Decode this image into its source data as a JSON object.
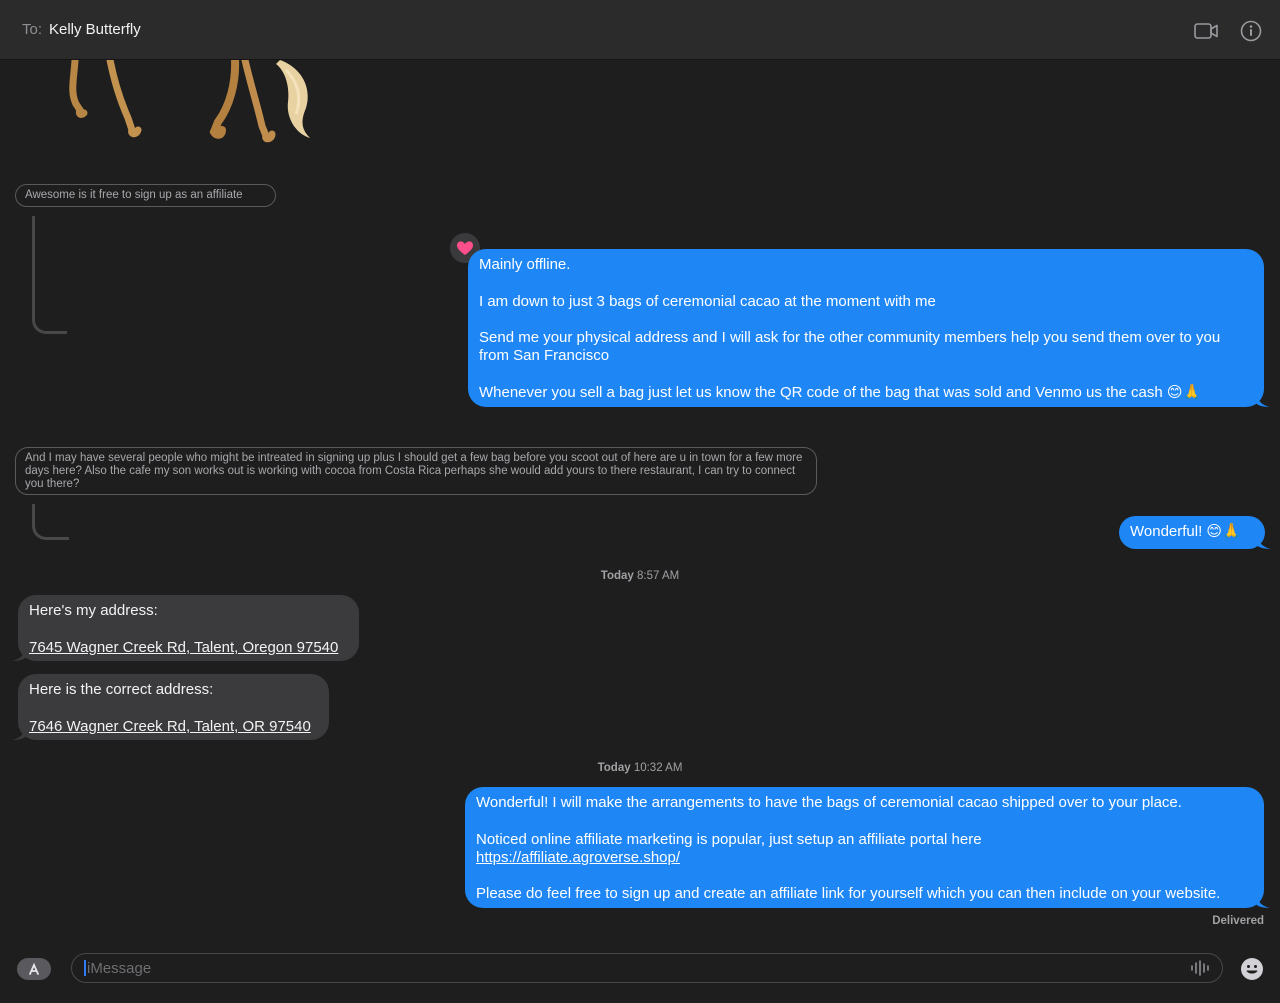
{
  "header": {
    "to_label": "To:",
    "recipient": "Kelly Butterfly",
    "icons": [
      "video-camera-icon",
      "info-icon"
    ]
  },
  "replies": {
    "reply1": "Awesome is it free to sign up as an affiliate",
    "reply2": "And I may have several people who might be intreated in signing up plus I should get a few bag before you scoot out of here are u in town for a few more days here?  Also the cafe my son works out is working with cocoa from Costa Rica perhaps she would add yours to there restaurant, I can try to connect you there?"
  },
  "messages": {
    "m1": {
      "l1": "Mainly offline.",
      "l2": "I am down to just 3 bags of ceremonial cacao at the moment with me",
      "l3": "Send me your physical address and I will ask for the other community members help you send them over to you from San Francisco",
      "l4": "Whenever you sell a bag just let us know the QR code of the bag that was sold and Venmo us the cash 😊🙏",
      "tapback": "heart"
    },
    "m2": {
      "text": "Wonderful! 😊🙏"
    },
    "m3": {
      "l1": "Here's my address:",
      "l2": "7645 Wagner Creek Rd, Talent, Oregon 97540"
    },
    "m4": {
      "l1": "Here is the correct address:",
      "l2": "7646 Wagner Creek Rd, Talent, OR 97540"
    },
    "m5": {
      "l1": "Wonderful! I will make the arrangements to have the bags of ceremonial cacao shipped over to your place.",
      "l2": "Noticed online affiliate marketing is popular, just setup an affiliate portal here",
      "l3": "https://affiliate.agroverse.shop/",
      "l4": "Please do feel free to sign up and create an affiliate link for yourself which you can then include on your website."
    }
  },
  "timestamps": {
    "t1_day": "Today",
    "t1_time": "8:57 AM",
    "t2_day": "Today",
    "t2_time": "10:32 AM"
  },
  "status": {
    "delivered": "Delivered"
  },
  "composer": {
    "placeholder": "iMessage"
  },
  "colors": {
    "blue_bubble": "#1e86f5",
    "gray_bubble": "#3b3b3d",
    "background": "#1e1e1e",
    "heart": "#ff4f8b"
  }
}
